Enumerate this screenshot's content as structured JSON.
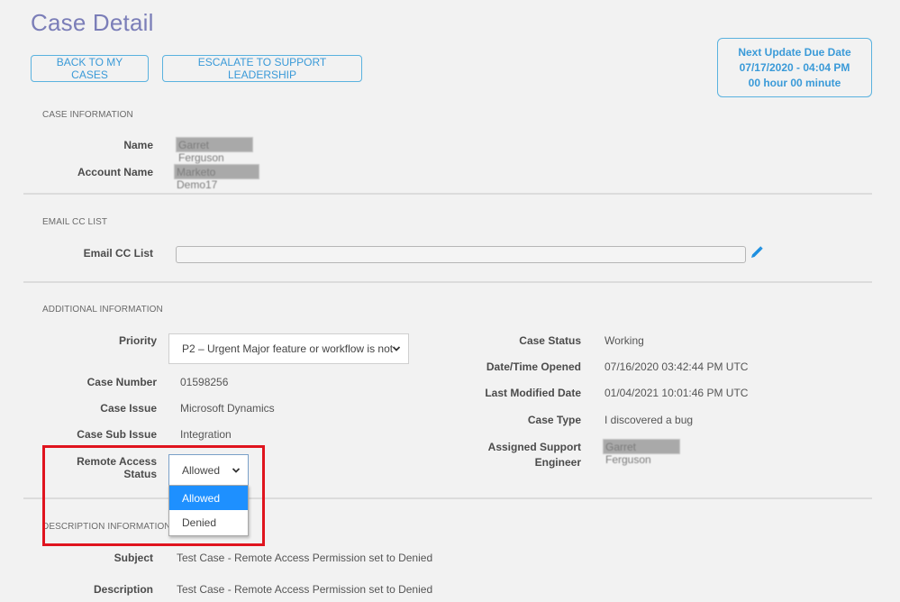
{
  "header": {
    "title": "Case Detail",
    "back_button": "BACK TO MY CASES",
    "escalate_button": "ESCALATE TO SUPPORT LEADERSHIP"
  },
  "next_update": {
    "title": "Next Update Due Date",
    "date": "07/17/2020 - 04:04 PM",
    "remaining": "00 hour 00 minute"
  },
  "case_information": {
    "section_title": "CASE INFORMATION",
    "name_label": "Name",
    "name_value": "Garret Ferguson",
    "account_label": "Account Name",
    "account_value": "Marketo Demo17"
  },
  "email_cc": {
    "section_title": "EMAIL CC LIST",
    "label": "Email CC List",
    "value": "",
    "edit_icon": "pencil-icon"
  },
  "additional_information": {
    "section_title": "ADDITIONAL INFORMATION",
    "left": {
      "priority_label": "Priority",
      "priority_value": "P2 – Urgent Major feature or workflow is not",
      "case_number_label": "Case Number",
      "case_number_value": "01598256",
      "case_issue_label": "Case Issue",
      "case_issue_value": "Microsoft Dynamics",
      "case_sub_issue_label": "Case Sub Issue",
      "case_sub_issue_value": "Integration",
      "remote_access_label": "Remote Access Status",
      "remote_access_value": "Allowed",
      "remote_access_options": [
        "Allowed",
        "Denied"
      ],
      "remote_access_highlighted": "Allowed"
    },
    "right": {
      "case_status_label": "Case Status",
      "case_status_value": "Working",
      "opened_label": "Date/Time Opened",
      "opened_value": "07/16/2020 03:42:44 PM UTC",
      "modified_label": "Last Modified Date",
      "modified_value": "01/04/2021 10:01:46 PM UTC",
      "case_type_label": "Case Type",
      "case_type_value": "I discovered a bug",
      "engineer_label_line1": "Assigned Support",
      "engineer_label_line2": "Engineer",
      "engineer_value": "Garret Ferguson"
    }
  },
  "description_information": {
    "section_title": "DESCRIPTION INFORMATION",
    "subject_label": "Subject",
    "subject_value": "Test Case - Remote Access Permission set to Denied",
    "description_label": "Description",
    "description_value": "Test Case - Remote Access Permission set to Denied"
  },
  "colors": {
    "accent": "#3a9ad8",
    "title": "#7b7eb8",
    "highlight_border": "#e0141e",
    "dropdown_selected": "#1e90ff"
  }
}
